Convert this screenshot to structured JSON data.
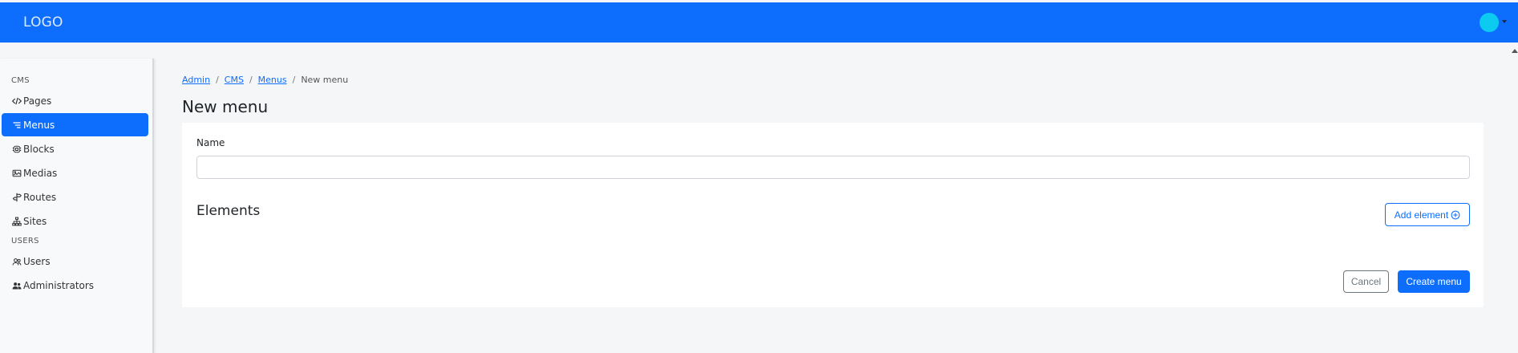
{
  "header": {
    "logo": "LOGO",
    "brand_color": "#0d6efd",
    "avatar_color": "#0dcaf0"
  },
  "sidebar": {
    "sections": [
      {
        "label": "CMS",
        "items": [
          {
            "label": "Pages",
            "icon": "code-icon"
          },
          {
            "label": "Menus",
            "icon": "menu-lines-icon",
            "active": true
          },
          {
            "label": "Blocks",
            "icon": "blocks-icon"
          },
          {
            "label": "Medias",
            "icon": "image-icon"
          },
          {
            "label": "Routes",
            "icon": "signpost-icon"
          },
          {
            "label": "Sites",
            "icon": "sitemap-icon"
          }
        ]
      },
      {
        "label": "USERS",
        "items": [
          {
            "label": "Users",
            "icon": "users-icon"
          },
          {
            "label": "Administrators",
            "icon": "admin-users-icon"
          }
        ]
      }
    ]
  },
  "breadcrumb": [
    {
      "label": "Admin",
      "link": true
    },
    {
      "label": "CMS",
      "link": true
    },
    {
      "label": "Menus",
      "link": true
    },
    {
      "label": "New menu",
      "link": false
    }
  ],
  "page": {
    "title": "New menu"
  },
  "form": {
    "name_label": "Name",
    "name_value": "",
    "elements_title": "Elements",
    "add_element_label": "Add element",
    "cancel_label": "Cancel",
    "submit_label": "Create menu"
  }
}
